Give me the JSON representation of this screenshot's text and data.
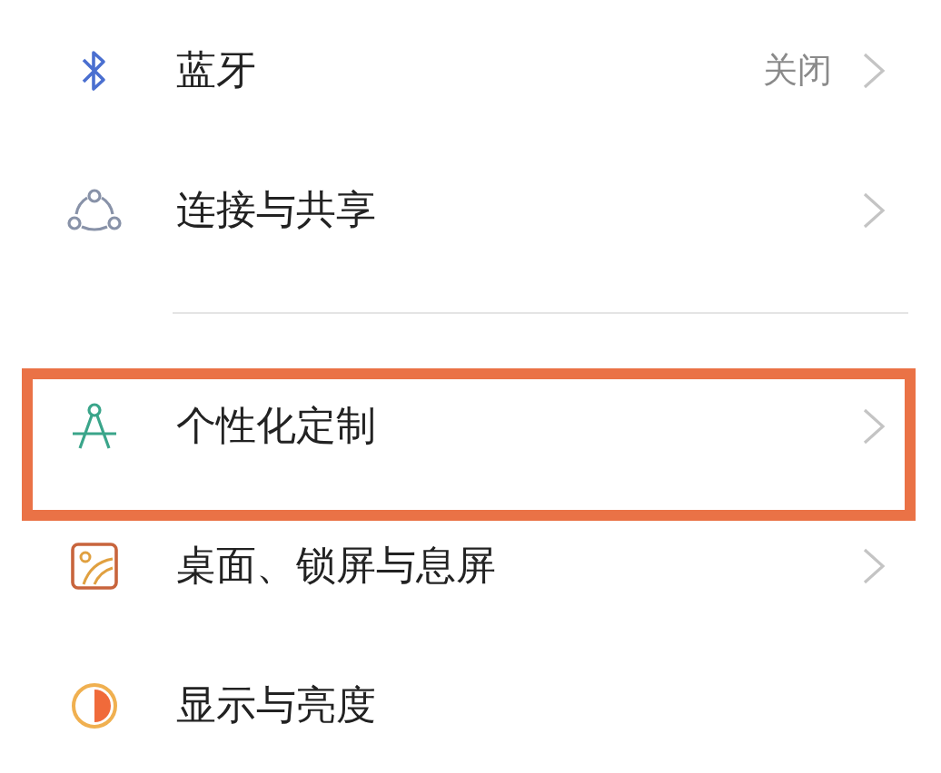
{
  "groups": [
    {
      "items": [
        {
          "label": "蓝牙",
          "value": "关闭",
          "chevron": true,
          "highlighted": false
        },
        {
          "label": "连接与共享",
          "chevron": true,
          "highlighted": false
        }
      ]
    },
    {
      "items": [
        {
          "label": "个性化定制",
          "chevron": true,
          "highlighted": true
        },
        {
          "label": "桌面、锁屏与息屏",
          "chevron": true,
          "highlighted": false
        },
        {
          "label": "显示与亮度",
          "chevron": false,
          "highlighted": false
        }
      ]
    }
  ]
}
